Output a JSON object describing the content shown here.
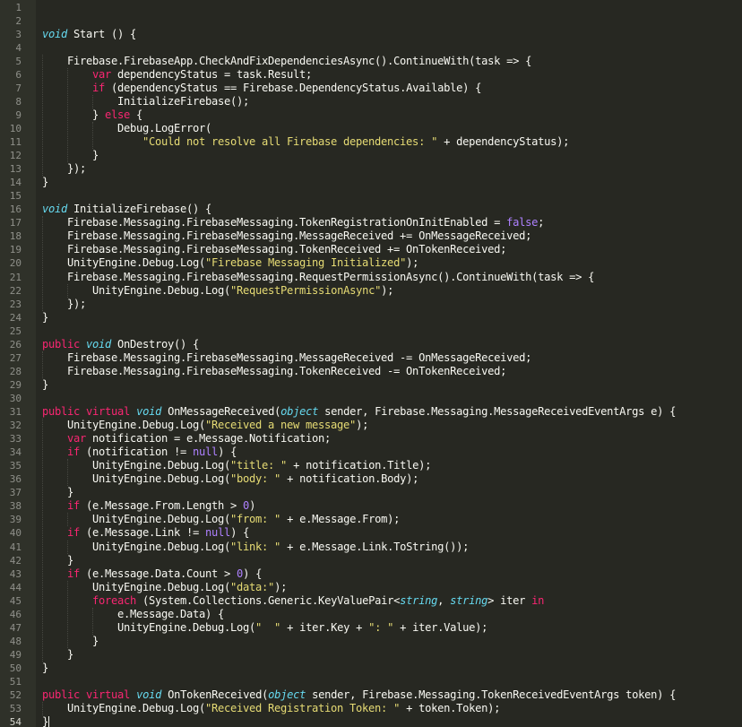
{
  "editor": {
    "theme": {
      "background": "#272822",
      "gutter": "#2f3129",
      "keyword": "#f92672",
      "type": "#66d9ef",
      "string": "#e6db74",
      "number": "#ae81ff",
      "plain": "#f8f8f2",
      "line_number": "#8f908a"
    },
    "current_line": 54,
    "lines": [
      {
        "n": "1",
        "tokens": []
      },
      {
        "n": "2",
        "tokens": []
      },
      {
        "n": "3",
        "tokens": [
          [
            "ty",
            "void"
          ],
          [
            "pl",
            " Start () {"
          ]
        ]
      },
      {
        "n": "4",
        "tokens": []
      },
      {
        "n": "5",
        "tokens": [
          [
            "pl",
            "    Firebase.FirebaseApp.CheckAndFixDependenciesAsync().ContinueWith(task => {"
          ]
        ]
      },
      {
        "n": "6",
        "tokens": [
          [
            "kw",
            "        var"
          ],
          [
            "pl",
            " dependencyStatus = task.Result;"
          ]
        ]
      },
      {
        "n": "7",
        "tokens": [
          [
            "kw",
            "        if"
          ],
          [
            "pl",
            " (dependencyStatus == Firebase.DependencyStatus.Available) {"
          ]
        ]
      },
      {
        "n": "8",
        "tokens": [
          [
            "pl",
            "            InitializeFirebase();"
          ]
        ]
      },
      {
        "n": "9",
        "tokens": [
          [
            "pl",
            "        } "
          ],
          [
            "kw",
            "else"
          ],
          [
            "pl",
            " {"
          ]
        ]
      },
      {
        "n": "10",
        "tokens": [
          [
            "pl",
            "            Debug.LogError("
          ]
        ]
      },
      {
        "n": "11",
        "tokens": [
          [
            "st",
            "                \"Could not resolve all Firebase dependencies: \""
          ],
          [
            "pl",
            " + dependencyStatus);"
          ]
        ]
      },
      {
        "n": "12",
        "tokens": [
          [
            "pl",
            "        }"
          ]
        ]
      },
      {
        "n": "13",
        "tokens": [
          [
            "pl",
            "    });"
          ]
        ]
      },
      {
        "n": "14",
        "tokens": [
          [
            "pl",
            "}"
          ]
        ]
      },
      {
        "n": "15",
        "tokens": []
      },
      {
        "n": "16",
        "tokens": [
          [
            "ty",
            "void"
          ],
          [
            "pl",
            " InitializeFirebase() {"
          ]
        ]
      },
      {
        "n": "17",
        "tokens": [
          [
            "pl",
            "    Firebase.Messaging.FirebaseMessaging.TokenRegistrationOnInitEnabled = "
          ],
          [
            "nu",
            "false"
          ],
          [
            "pl",
            ";"
          ]
        ]
      },
      {
        "n": "18",
        "tokens": [
          [
            "pl",
            "    Firebase.Messaging.FirebaseMessaging.MessageReceived += OnMessageReceived;"
          ]
        ]
      },
      {
        "n": "19",
        "tokens": [
          [
            "pl",
            "    Firebase.Messaging.FirebaseMessaging.TokenReceived += OnTokenReceived;"
          ]
        ]
      },
      {
        "n": "20",
        "tokens": [
          [
            "pl",
            "    UnityEngine.Debug.Log("
          ],
          [
            "st",
            "\"Firebase Messaging Initialized\""
          ],
          [
            "pl",
            ");"
          ]
        ]
      },
      {
        "n": "21",
        "tokens": [
          [
            "pl",
            "    Firebase.Messaging.FirebaseMessaging.RequestPermissionAsync().ContinueWith(task => {"
          ]
        ]
      },
      {
        "n": "22",
        "tokens": [
          [
            "pl",
            "        UnityEngine.Debug.Log("
          ],
          [
            "st",
            "\"RequestPermissionAsync\""
          ],
          [
            "pl",
            ");"
          ]
        ]
      },
      {
        "n": "23",
        "tokens": [
          [
            "pl",
            "    });"
          ]
        ]
      },
      {
        "n": "24",
        "tokens": [
          [
            "pl",
            "}"
          ]
        ]
      },
      {
        "n": "25",
        "tokens": []
      },
      {
        "n": "26",
        "tokens": [
          [
            "kw",
            "public"
          ],
          [
            "pl",
            " "
          ],
          [
            "ty",
            "void"
          ],
          [
            "pl",
            " OnDestroy() {"
          ]
        ]
      },
      {
        "n": "27",
        "tokens": [
          [
            "pl",
            "    Firebase.Messaging.FirebaseMessaging.MessageReceived -= OnMessageReceived;"
          ]
        ]
      },
      {
        "n": "28",
        "tokens": [
          [
            "pl",
            "    Firebase.Messaging.FirebaseMessaging.TokenReceived -= OnTokenReceived;"
          ]
        ]
      },
      {
        "n": "29",
        "tokens": [
          [
            "pl",
            "}"
          ]
        ]
      },
      {
        "n": "30",
        "tokens": []
      },
      {
        "n": "31",
        "tokens": [
          [
            "kw",
            "public"
          ],
          [
            "pl",
            " "
          ],
          [
            "kw",
            "virtual"
          ],
          [
            "pl",
            " "
          ],
          [
            "ty",
            "void"
          ],
          [
            "pl",
            " OnMessageReceived("
          ],
          [
            "ty",
            "object"
          ],
          [
            "pl",
            " sender, Firebase.Messaging.MessageReceivedEventArgs e) {"
          ]
        ]
      },
      {
        "n": "32",
        "tokens": [
          [
            "pl",
            "    UnityEngine.Debug.Log("
          ],
          [
            "st",
            "\"Received a new message\""
          ],
          [
            "pl",
            ");"
          ]
        ]
      },
      {
        "n": "33",
        "tokens": [
          [
            "kw",
            "    var"
          ],
          [
            "pl",
            " notification = e.Message.Notification;"
          ]
        ]
      },
      {
        "n": "34",
        "tokens": [
          [
            "kw",
            "    if"
          ],
          [
            "pl",
            " (notification != "
          ],
          [
            "nu",
            "null"
          ],
          [
            "pl",
            ") {"
          ]
        ]
      },
      {
        "n": "35",
        "tokens": [
          [
            "pl",
            "        UnityEngine.Debug.Log("
          ],
          [
            "st",
            "\"title: \""
          ],
          [
            "pl",
            " + notification.Title);"
          ]
        ]
      },
      {
        "n": "36",
        "tokens": [
          [
            "pl",
            "        UnityEngine.Debug.Log("
          ],
          [
            "st",
            "\"body: \""
          ],
          [
            "pl",
            " + notification.Body);"
          ]
        ]
      },
      {
        "n": "37",
        "tokens": [
          [
            "pl",
            "    }"
          ]
        ]
      },
      {
        "n": "38",
        "tokens": [
          [
            "kw",
            "    if"
          ],
          [
            "pl",
            " (e.Message.From.Length > "
          ],
          [
            "nu",
            "0"
          ],
          [
            "pl",
            ")"
          ]
        ]
      },
      {
        "n": "39",
        "tokens": [
          [
            "pl",
            "        UnityEngine.Debug.Log("
          ],
          [
            "st",
            "\"from: \""
          ],
          [
            "pl",
            " + e.Message.From);"
          ]
        ]
      },
      {
        "n": "40",
        "tokens": [
          [
            "kw",
            "    if"
          ],
          [
            "pl",
            " (e.Message.Link != "
          ],
          [
            "nu",
            "null"
          ],
          [
            "pl",
            ") {"
          ]
        ]
      },
      {
        "n": "41",
        "tokens": [
          [
            "pl",
            "        UnityEngine.Debug.Log("
          ],
          [
            "st",
            "\"link: \""
          ],
          [
            "pl",
            " + e.Message.Link.ToString());"
          ]
        ]
      },
      {
        "n": "42",
        "tokens": [
          [
            "pl",
            "    }"
          ]
        ]
      },
      {
        "n": "43",
        "tokens": [
          [
            "kw",
            "    if"
          ],
          [
            "pl",
            " (e.Message.Data.Count > "
          ],
          [
            "nu",
            "0"
          ],
          [
            "pl",
            ") {"
          ]
        ]
      },
      {
        "n": "44",
        "tokens": [
          [
            "pl",
            "        UnityEngine.Debug.Log("
          ],
          [
            "st",
            "\"data:\""
          ],
          [
            "pl",
            ");"
          ]
        ]
      },
      {
        "n": "45",
        "tokens": [
          [
            "kw",
            "        foreach"
          ],
          [
            "pl",
            " (System.Collections.Generic.KeyValuePair<"
          ],
          [
            "ty",
            "string"
          ],
          [
            "pl",
            ", "
          ],
          [
            "ty",
            "string"
          ],
          [
            "pl",
            "> iter "
          ],
          [
            "kw",
            "in"
          ]
        ]
      },
      {
        "n": "46",
        "tokens": [
          [
            "pl",
            "            e.Message.Data) {"
          ]
        ]
      },
      {
        "n": "47",
        "tokens": [
          [
            "pl",
            "            UnityEngine.Debug.Log("
          ],
          [
            "st",
            "\"  \""
          ],
          [
            "pl",
            " + iter.Key + "
          ],
          [
            "st",
            "\": \""
          ],
          [
            "pl",
            " + iter.Value);"
          ]
        ]
      },
      {
        "n": "48",
        "tokens": [
          [
            "pl",
            "        }"
          ]
        ]
      },
      {
        "n": "49",
        "tokens": [
          [
            "pl",
            "    }"
          ]
        ]
      },
      {
        "n": "50",
        "tokens": [
          [
            "pl",
            "}"
          ]
        ]
      },
      {
        "n": "51",
        "tokens": []
      },
      {
        "n": "52",
        "tokens": [
          [
            "kw",
            "public"
          ],
          [
            "pl",
            " "
          ],
          [
            "kw",
            "virtual"
          ],
          [
            "pl",
            " "
          ],
          [
            "ty",
            "void"
          ],
          [
            "pl",
            " OnTokenReceived("
          ],
          [
            "ty",
            "object"
          ],
          [
            "pl",
            " sender, Firebase.Messaging.TokenReceivedEventArgs token) {"
          ]
        ]
      },
      {
        "n": "53",
        "tokens": [
          [
            "pl",
            "    UnityEngine.Debug.Log("
          ],
          [
            "st",
            "\"Received Registration Token: \""
          ],
          [
            "pl",
            " + token.Token);"
          ]
        ]
      },
      {
        "n": "54",
        "tokens": [
          [
            "pl",
            "}"
          ]
        ]
      }
    ]
  }
}
